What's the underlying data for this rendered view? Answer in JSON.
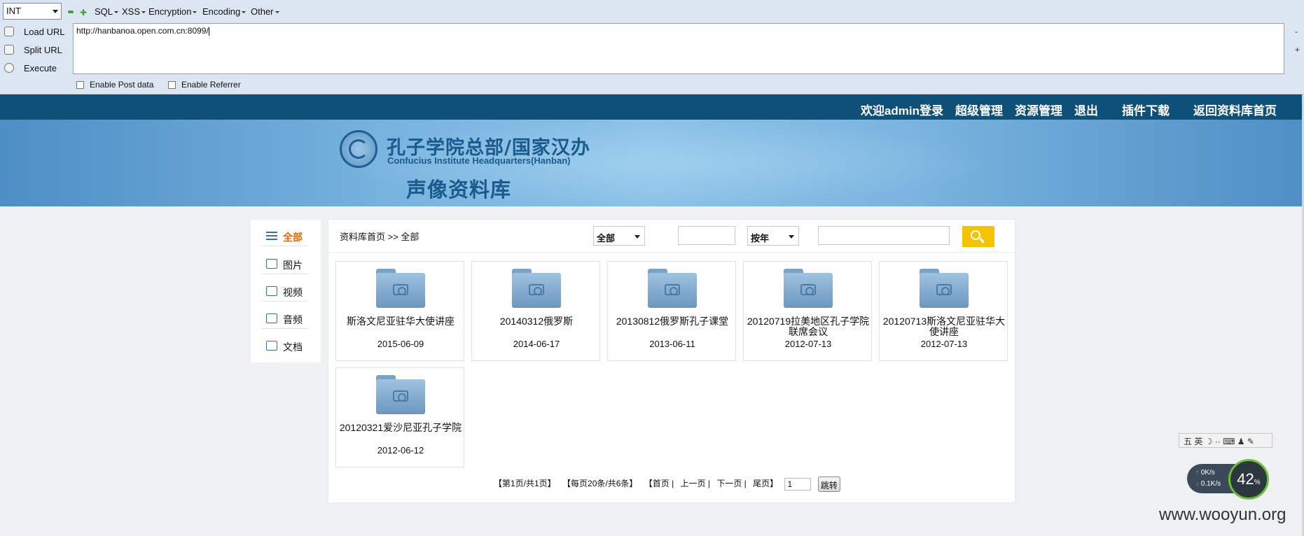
{
  "hackbar": {
    "select_value": "INT",
    "menu": [
      "SQL",
      "XSS",
      "Encryption",
      "Encoding",
      "Other"
    ],
    "actions": [
      "Load URL",
      "Split URL",
      "Execute"
    ],
    "url": "http://hanbanoa.open.com.cn:8099/",
    "edge_minus": "-",
    "edge_plus": "+",
    "enable_post": "Enable Post data",
    "enable_referrer": "Enable Referrer"
  },
  "site_nav": [
    "欢迎admin登录",
    "超级管理",
    "资源管理",
    "退出",
    "插件下载",
    "返回资料库首页"
  ],
  "logo": {
    "cn": "孔子学院总部/国家汉办",
    "en": "Confucius Institute Headquarters(Hanban)",
    "subtitle": "声像资料库"
  },
  "sidebar": {
    "items": [
      {
        "label": "全部",
        "icon": "list-icon",
        "active": true
      },
      {
        "label": "图片",
        "icon": "camera-icon"
      },
      {
        "label": "视频",
        "icon": "video-icon"
      },
      {
        "label": "音频",
        "icon": "speaker-icon"
      },
      {
        "label": "文档",
        "icon": "mail-icon"
      }
    ]
  },
  "breadcrumb": "资料库首页  >>  全部",
  "filters": {
    "category": "全部",
    "period": "按年",
    "search_value": ""
  },
  "cards": [
    {
      "title": "斯洛文尼亚驻华大使讲座",
      "date": "2015-06-09"
    },
    {
      "title": "20140312俄罗斯",
      "date": "2014-06-17"
    },
    {
      "title": "20130812俄罗斯孔子课堂",
      "date": "2013-06-11"
    },
    {
      "title": "20120719拉美地区孔子学院联席会议",
      "date": "2012-07-13"
    },
    {
      "title": "20120713斯洛文尼亚驻华大使讲座",
      "date": "2012-07-13"
    },
    {
      "title": "20120321爱沙尼亚孔子学院",
      "date": "2012-06-12"
    }
  ],
  "pager": {
    "page_info": "【第1页/共1页】",
    "per_page": "【每页20条/共6条】",
    "first": "【首页 |",
    "prev": "上一页 |",
    "next": "下一页 |",
    "last": "尾页】",
    "page_value": "1",
    "jump": "跳转"
  },
  "overlays": {
    "ime": "五  英  ☽ ·· ⌨ ♟ ✎",
    "net_up": "0K/s",
    "net_down": "0.1K/s",
    "gauge": "42",
    "gauge_unit": "%",
    "watermark": "www.wooyun.org"
  }
}
